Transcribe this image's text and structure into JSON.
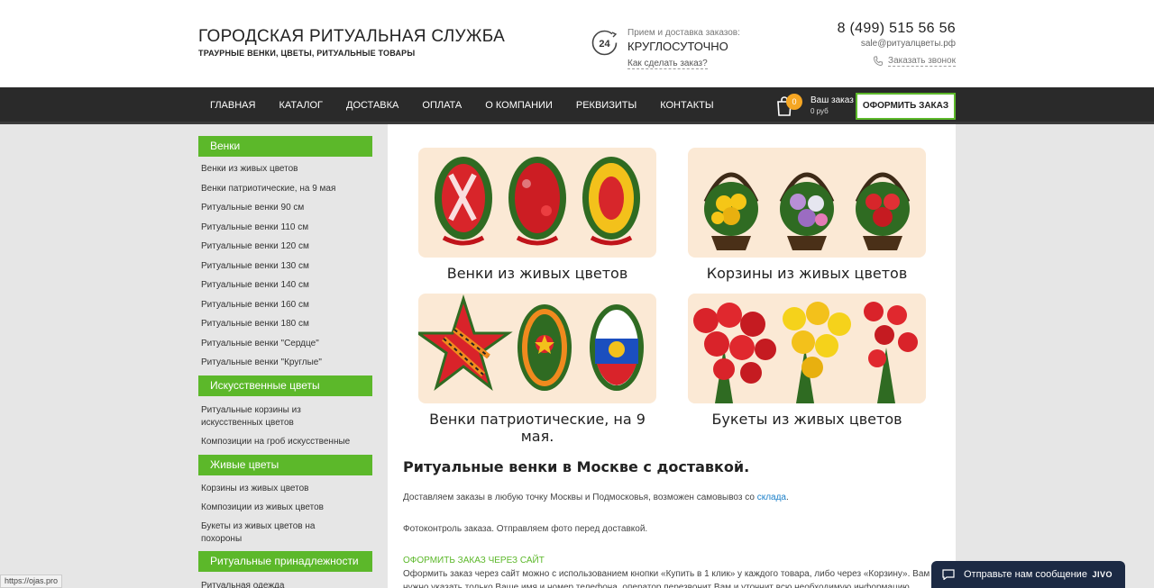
{
  "header": {
    "title": "ГОРОДСКАЯ РИТУАЛЬНАЯ СЛУЖБА",
    "subtitle": "ТРАУРНЫЕ ВЕНКИ, ЦВЕТЫ, РИТУАЛЬНЫЕ ТОВАРЫ",
    "clock_text": "24",
    "delivery_label": "Прием и доставка заказов:",
    "delivery_value": "КРУГЛОСУТОЧНО",
    "howto_link": "Как сделать заказ?",
    "phone": "8 (499) 515 56 56",
    "email": "sale@ритуалцветы.рф",
    "callback_link": "Заказать звонок"
  },
  "nav": {
    "items": [
      "ГЛАВНАЯ",
      "КАТАЛОГ",
      "ДОСТАВКА",
      "ОПЛАТА",
      "О КОМПАНИИ",
      "РЕКВИЗИТЫ",
      "КОНТАКТЫ"
    ],
    "cart_count": "0",
    "cart_label": "Ваш заказ",
    "cart_sum": "0 руб",
    "checkout_label": "ОФОРМИТЬ ЗАКАЗ"
  },
  "sidebar": {
    "cat1": {
      "title": "Венки",
      "items": [
        "Венки из живых цветов",
        "Венки патриотические, на 9 мая",
        "Ритуальные венки 90 см",
        "Ритуальные венки 110 см",
        "Ритуальные венки 120 см",
        "Ритуальные венки 130 см",
        "Ритуальные венки 140 см",
        "Ритуальные венки 160 см",
        "Ритуальные венки 180 см",
        "Ритуальные венки \"Сердце\"",
        "Ритуальные венки \"Круглые\""
      ]
    },
    "cat2": {
      "title": "Искусственные цветы",
      "items": [
        "Ритуальные корзины из искусственных цветов",
        "Композиции на гроб искусственные"
      ]
    },
    "cat3": {
      "title": "Живые цветы",
      "items": [
        "Корзины из живых цветов",
        "Композиции из живых цветов",
        "Букеты из живых цветов на похороны"
      ]
    },
    "cat4": {
      "title": "Ритуальные принадлежности",
      "items": [
        "Ритуальная одежда"
      ]
    }
  },
  "cards": [
    {
      "caption": "Венки из живых цветов"
    },
    {
      "caption": "Корзины из живых цветов"
    },
    {
      "caption": "Венки патриотические, на 9 мая."
    },
    {
      "caption": "Букеты из живых цветов"
    }
  ],
  "content": {
    "heading": "Ритуальные венки в Москве с доставкой.",
    "p1_text": "Доставляем заказы в любую точку Москвы и Подмосковья, возможен самовывоз со ",
    "p1_link": "склада",
    "p1_end": ".",
    "p2": "Фотоконтроль заказа. Отправляем фото перед доставкой.",
    "order_link": "ОФОРМИТЬ ЗАКАЗ ЧЕРЕЗ САЙТ",
    "p3": "Оформить заказ через сайт можно с использованием кнопки «Купить в 1 клик» у каждого товара, либо через «Корзину». Вам нужно указать только Ваше имя и номер телефона, оператор перезвонит Вам и уточнит всю необходимую информацию."
  },
  "chat": {
    "label": "Отправьте нам сообщение",
    "brand": "JIVO"
  },
  "status_url": "https://ojas.pro",
  "colors": {
    "accent_green": "#5cb82a",
    "nav_bg": "#2a2a2a",
    "badge_orange": "#f5a623",
    "card_bg": "#fbe9d5",
    "chat_bg": "#1c2a44"
  }
}
